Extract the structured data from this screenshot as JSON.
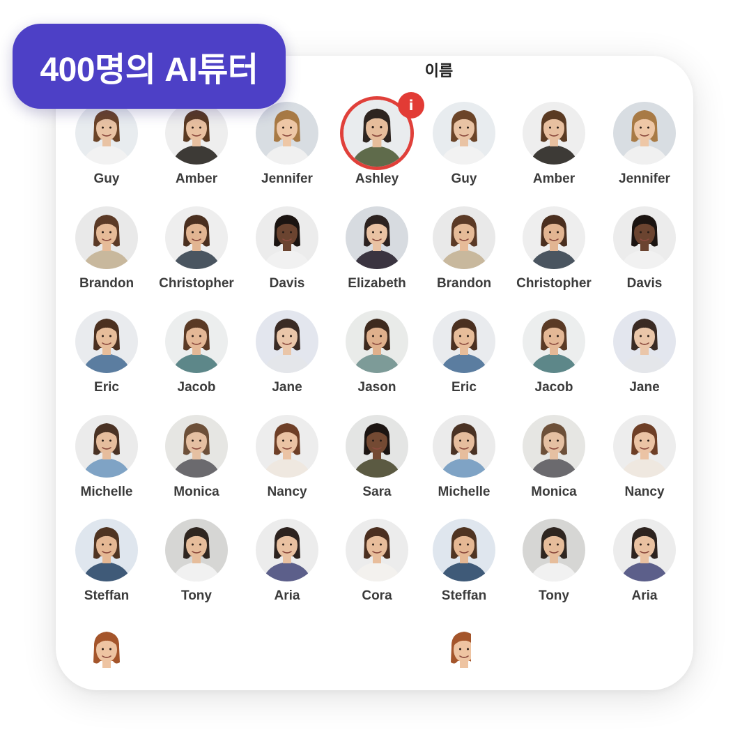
{
  "badge": {
    "label": "400명의 AI튜터"
  },
  "list": {
    "column_header": "이름"
  },
  "selected_index": 3,
  "tutors": [
    {
      "name": "Guy",
      "skin": "#e9c3a4",
      "hair": "#6b4428",
      "shirt": "#f2f2f2",
      "bg": "#e8ecef"
    },
    {
      "name": "Amber",
      "skin": "#e8c0a0",
      "hair": "#5a3a22",
      "shirt": "#3d3a36",
      "bg": "#eeeeee"
    },
    {
      "name": "Jennifer",
      "skin": "#eec7a6",
      "hair": "#a87a45",
      "shirt": "#f0f0f0",
      "bg": "#d8dde2"
    },
    {
      "name": "Ashley",
      "skin": "#e6bd9b",
      "hair": "#2e2520",
      "shirt": "#5f6b4b",
      "bg": "#e9ecee"
    },
    {
      "name": "Guy",
      "skin": "#e9c3a4",
      "hair": "#6b4428",
      "shirt": "#f2f2f2",
      "bg": "#e8ecef"
    },
    {
      "name": "Amber",
      "skin": "#e8c0a0",
      "hair": "#5a3a22",
      "shirt": "#3d3a36",
      "bg": "#eeeeee"
    },
    {
      "name": "Jennifer",
      "skin": "#eec7a6",
      "hair": "#a87a45",
      "shirt": "#f0f0f0",
      "bg": "#d8dde2"
    },
    {
      "name": "Brandon",
      "skin": "#e6bb98",
      "hair": "#5b3a26",
      "shirt": "#c8b89d",
      "bg": "#e9e9e9"
    },
    {
      "name": "Christopher",
      "skin": "#e2b592",
      "hair": "#4a2f1f",
      "shirt": "#4a5560",
      "bg": "#eeeeee"
    },
    {
      "name": "Davis",
      "skin": "#6b4430",
      "hair": "#1b1411",
      "shirt": "#f1f1f1",
      "bg": "#ececec"
    },
    {
      "name": "Elizabeth",
      "skin": "#e9c2a3",
      "hair": "#2c2220",
      "shirt": "#3a3440",
      "bg": "#d7dbe0"
    },
    {
      "name": "Brandon",
      "skin": "#e6bb98",
      "hair": "#5b3a26",
      "shirt": "#c8b89d",
      "bg": "#e9e9e9"
    },
    {
      "name": "Christopher",
      "skin": "#e2b592",
      "hair": "#4a2f1f",
      "shirt": "#4a5560",
      "bg": "#eeeeee"
    },
    {
      "name": "Davis",
      "skin": "#6b4430",
      "hair": "#1b1411",
      "shirt": "#f1f1f1",
      "bg": "#ececec"
    },
    {
      "name": "Eric",
      "skin": "#e7bd9a",
      "hair": "#4b3020",
      "shirt": "#5b7da0",
      "bg": "#e9ebee"
    },
    {
      "name": "Jacob",
      "skin": "#e4b896",
      "hair": "#5a3a25",
      "shirt": "#5d8789",
      "bg": "#eceeee"
    },
    {
      "name": "Jane",
      "skin": "#eac6a9",
      "hair": "#3a2b24",
      "shirt": "#e4e6ea",
      "bg": "#e3e6ee"
    },
    {
      "name": "Jason",
      "skin": "#dfb08c",
      "hair": "#3e2a1e",
      "shirt": "#7d9b98",
      "bg": "#e9ebe9"
    },
    {
      "name": "Eric",
      "skin": "#e7bd9a",
      "hair": "#4b3020",
      "shirt": "#5b7da0",
      "bg": "#e9ebee"
    },
    {
      "name": "Jacob",
      "skin": "#e4b896",
      "hair": "#5a3a25",
      "shirt": "#5d8789",
      "bg": "#eceeee"
    },
    {
      "name": "Jane",
      "skin": "#eac6a9",
      "hair": "#3a2b24",
      "shirt": "#e4e6ea",
      "bg": "#e3e6ee"
    },
    {
      "name": "Michelle",
      "skin": "#e6bd9d",
      "hair": "#4a3224",
      "shirt": "#7fa3c5",
      "bg": "#ebebeb"
    },
    {
      "name": "Monica",
      "skin": "#e5c0a2",
      "hair": "#6d5039",
      "shirt": "#6b6a6e",
      "bg": "#e6e6e3"
    },
    {
      "name": "Nancy",
      "skin": "#ebc3a4",
      "hair": "#6e3f27",
      "shirt": "#efe8e0",
      "bg": "#ededed"
    },
    {
      "name": "Sara",
      "skin": "#744a33",
      "hair": "#1c1512",
      "shirt": "#5b5a42",
      "bg": "#e4e5e4"
    },
    {
      "name": "Michelle",
      "skin": "#e6bd9d",
      "hair": "#4a3224",
      "shirt": "#7fa3c5",
      "bg": "#ebebeb"
    },
    {
      "name": "Monica",
      "skin": "#e5c0a2",
      "hair": "#6d5039",
      "shirt": "#6b6a6e",
      "bg": "#e6e6e3"
    },
    {
      "name": "Nancy",
      "skin": "#ebc3a4",
      "hair": "#6e3f27",
      "shirt": "#efe8e0",
      "bg": "#ededed"
    },
    {
      "name": "Steffan",
      "skin": "#e5b894",
      "hair": "#4f3422",
      "shirt": "#3f5a78",
      "bg": "#dfe6ee"
    },
    {
      "name": "Tony",
      "skin": "#e6bd9b",
      "hair": "#2f2620",
      "shirt": "#f1f1f1",
      "bg": "#d6d6d4"
    },
    {
      "name": "Aria",
      "skin": "#e9c1a1",
      "hair": "#2d231f",
      "shirt": "#5c5f8a",
      "bg": "#ececec"
    },
    {
      "name": "Cora",
      "skin": "#e8bd9b",
      "hair": "#4b2f20",
      "shirt": "#f3f1ee",
      "bg": "#ececec"
    },
    {
      "name": "Steffan",
      "skin": "#e5b894",
      "hair": "#4f3422",
      "shirt": "#3f5a78",
      "bg": "#dfe6ee"
    },
    {
      "name": "Tony",
      "skin": "#e6bd9b",
      "hair": "#2f2620",
      "shirt": "#f1f1f1",
      "bg": "#d6d6d4"
    },
    {
      "name": "Aria",
      "skin": "#e9c1a1",
      "hair": "#2d231f",
      "shirt": "#5c5f8a",
      "bg": "#ececec"
    }
  ],
  "partial_row": [
    {
      "skin": "#eec4a2",
      "hair": "#a4552b",
      "shirt": "#ffffff",
      "bg": "#ffffff"
    },
    {
      "skin": "#eec4a2",
      "hair": "#a4552b",
      "shirt": "#ffffff",
      "bg": "#ffffff"
    }
  ]
}
